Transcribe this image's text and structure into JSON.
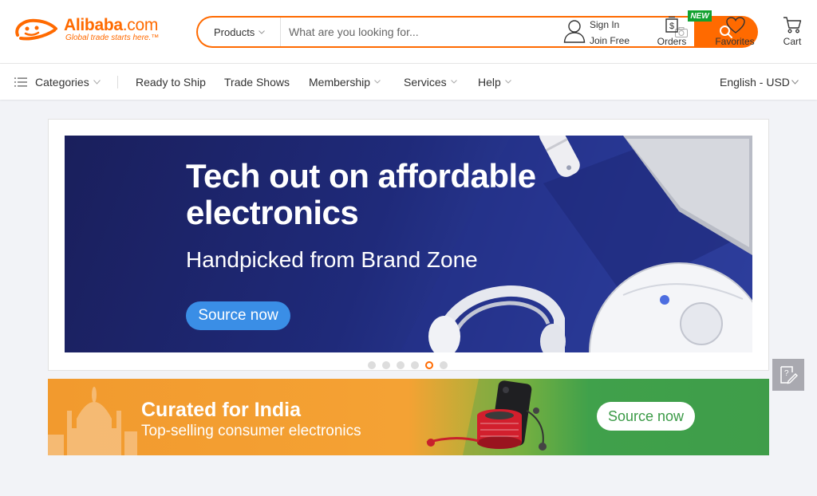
{
  "brand": {
    "name": "Alibaba",
    "suffix": ".com",
    "tagline": "Global trade starts here.",
    "trademark": "™",
    "color": "#ff6a00"
  },
  "search": {
    "category": "Products",
    "placeholder": "What are you looking for...",
    "icons": [
      "chevron-down-icon",
      "camera-icon",
      "search-icon"
    ]
  },
  "account": {
    "sign_in": "Sign In",
    "join_free": "Join Free"
  },
  "header_actions": {
    "orders": "Orders",
    "new_badge": "NEW",
    "favorites": "Favorites",
    "cart": "Cart"
  },
  "nav": {
    "categories": "Categories",
    "items": [
      "Ready to Ship",
      "Trade Shows",
      "Membership",
      "Services",
      "Help"
    ],
    "language": "English - USD"
  },
  "hero": {
    "title": "Tech out on affordable electronics",
    "subtitle": "Handpicked from Brand Zone",
    "button": "Source now",
    "slide_count": 6,
    "active_slide": 5,
    "button_color": "#3a8ee6"
  },
  "promo": {
    "title": "Curated for India",
    "subtitle": "Top-selling consumer electronics",
    "button": "Source now",
    "button_text_color": "#3a9a46"
  },
  "feedback": {
    "icon": "feedback-icon"
  }
}
